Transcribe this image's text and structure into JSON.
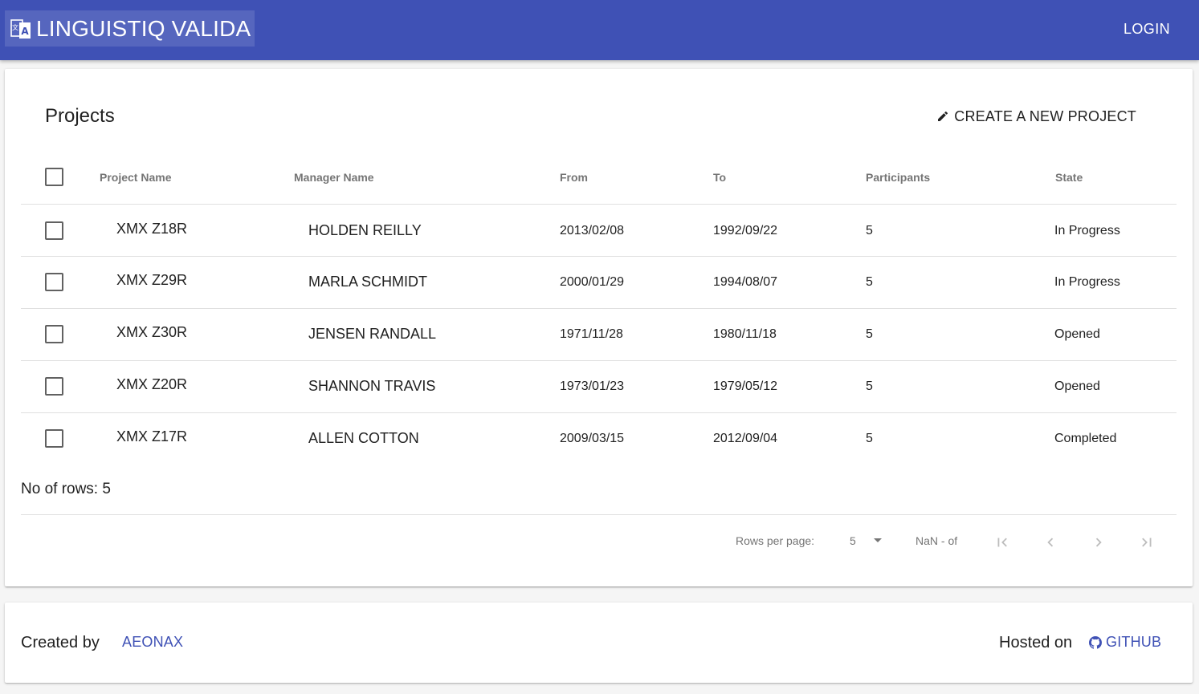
{
  "app": {
    "title": "LINGUISTIQ VALIDA",
    "login_label": "LOGIN",
    "accent_color": "#3f51b5"
  },
  "projects": {
    "title": "Projects",
    "create_label": "CREATE A NEW PROJECT",
    "columns": [
      "Project Name",
      "Manager Name",
      "From",
      "To",
      "Participants",
      "State"
    ],
    "rows": [
      {
        "name": "XMX Z18R",
        "manager": "HOLDEN REILLY",
        "from": "2013/02/08",
        "to": "1992/09/22",
        "participants": "5",
        "state": "In Progress"
      },
      {
        "name": "XMX Z29R",
        "manager": "MARLA SCHMIDT",
        "from": "2000/01/29",
        "to": "1994/08/07",
        "participants": "5",
        "state": "In Progress"
      },
      {
        "name": "XMX Z30R",
        "manager": "JENSEN RANDALL",
        "from": "1971/11/28",
        "to": "1980/11/18",
        "participants": "5",
        "state": "Opened"
      },
      {
        "name": "XMX Z20R",
        "manager": "SHANNON TRAVIS",
        "from": "1973/01/23",
        "to": "1979/05/12",
        "participants": "5",
        "state": "Opened"
      },
      {
        "name": "XMX Z17R",
        "manager": "ALLEN COTTON",
        "from": "2009/03/15",
        "to": "2012/09/04",
        "participants": "5",
        "state": "Completed"
      }
    ],
    "rows_count_label": "No of rows: 5"
  },
  "pagination": {
    "rows_per_page_label": "Rows per page:",
    "rows_per_page_value": "5",
    "range_label": "NaN - of"
  },
  "footer": {
    "created_by_label": "Created by",
    "author_link": "AEONAX",
    "hosted_on_label": "Hosted on",
    "host_link": "GITHUB"
  }
}
